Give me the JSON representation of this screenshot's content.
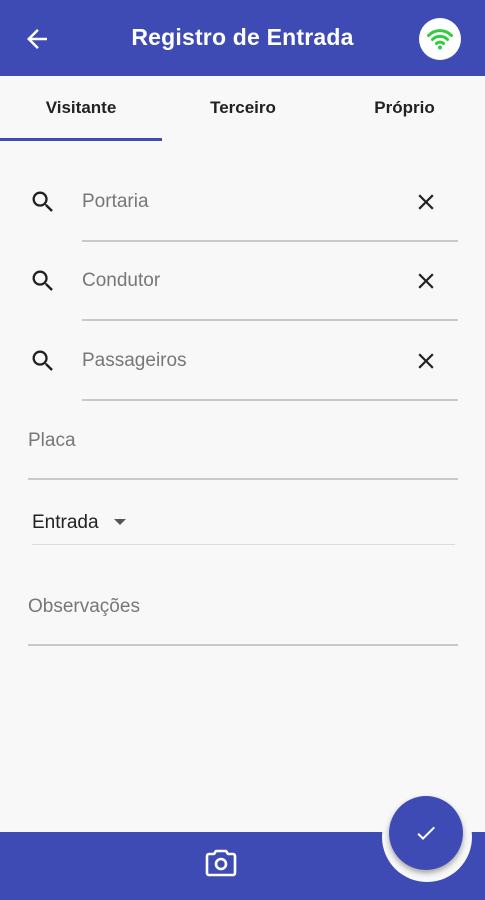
{
  "header": {
    "title": "Registro de Entrada",
    "back_icon": "arrow-left-icon",
    "status_icon": "wifi-icon",
    "status_color": "#2ecc40"
  },
  "tabs": [
    {
      "label": "Visitante",
      "selected": true
    },
    {
      "label": "Terceiro",
      "selected": false
    },
    {
      "label": "Próprio",
      "selected": false
    }
  ],
  "form": {
    "portaria": {
      "placeholder": "Portaria"
    },
    "condutor": {
      "placeholder": "Condutor"
    },
    "passageiros": {
      "placeholder": "Passageiros"
    },
    "placa": {
      "placeholder": "Placa"
    },
    "tipo": {
      "value": "Entrada"
    },
    "observacoes": {
      "placeholder": "Observações"
    }
  },
  "bottom": {
    "camera_icon": "camera-icon",
    "confirm_icon": "check-icon"
  },
  "colors": {
    "primary": "#3f4bb5",
    "background": "#f7f8f7"
  }
}
